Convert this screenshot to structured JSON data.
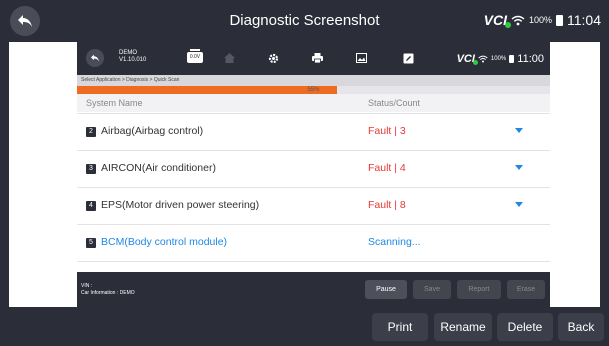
{
  "window": {
    "title": "Diagnostic Screenshot",
    "vci_label": "VCI",
    "battery_pct": "100%",
    "time": "11:04"
  },
  "screenshot": {
    "header": {
      "device_name": "DEMO",
      "version": "V1.10.010",
      "voltage": "0.0V",
      "vci_label": "VCI",
      "battery_pct": "100%",
      "time": "11:00"
    },
    "breadcrumb": "Select Application > Diagnosis > Quick Scan",
    "progress": {
      "value": 0.55,
      "label": "55%"
    },
    "columns": {
      "name": "System Name",
      "status": "Status/Count"
    },
    "rows": [
      {
        "num": "2",
        "name": "Airbag(Airbag control)",
        "status": "Fault | 3",
        "status_color": "#e53935",
        "name_color": "#333333",
        "expandable": true
      },
      {
        "num": "3",
        "name": "AIRCON(Air conditioner)",
        "status": "Fault | 4",
        "status_color": "#e53935",
        "name_color": "#333333",
        "expandable": true
      },
      {
        "num": "4",
        "name": "EPS(Motor driven power steering)",
        "status": "Fault | 8",
        "status_color": "#e53935",
        "name_color": "#333333",
        "expandable": true
      },
      {
        "num": "5",
        "name": "BCM(Body control module)",
        "status": "Scanning...",
        "status_color": "#1e88e5",
        "name_color": "#1e88e5",
        "expandable": false
      }
    ],
    "footer": {
      "vin_label": "VIN :",
      "car_info": "Car Information : DEMO",
      "buttons": [
        {
          "label": "Pause",
          "active": true
        },
        {
          "label": "Save",
          "active": false
        },
        {
          "label": "Report",
          "active": false
        },
        {
          "label": "Erase",
          "active": false
        }
      ]
    }
  },
  "bottom_buttons": [
    "Print",
    "Rename",
    "Delete",
    "Back"
  ],
  "colors": {
    "accent": "#ee6b22",
    "fault": "#e53935",
    "link": "#1e88e5",
    "bar": "#2b2d38"
  }
}
